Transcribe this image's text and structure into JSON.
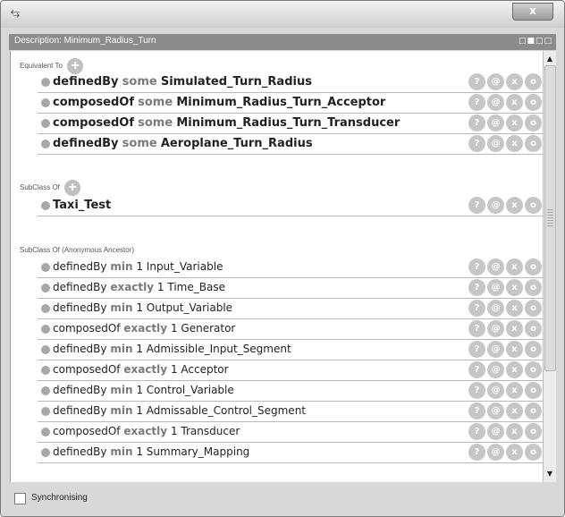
{
  "window": {
    "close_glyph": "x",
    "icon": "ontology-tool-icon"
  },
  "panel": {
    "title": "Description: Minimum_Radius_Turn",
    "controls": "□■□□"
  },
  "sections": {
    "equivalent": {
      "label": "Equivalent To",
      "rows": [
        {
          "prop": "definedBy",
          "kw": "some",
          "num": "",
          "target": "Simulated_Turn_Radius"
        },
        {
          "prop": "composedOf",
          "kw": "some",
          "num": "",
          "target": "Minimum_Radius_Turn_Acceptor"
        },
        {
          "prop": "composedOf",
          "kw": "some",
          "num": "",
          "target": "Minimum_Radius_Turn_Transducer"
        },
        {
          "prop": "definedBy",
          "kw": "some",
          "num": "",
          "target": "Aeroplane_Turn_Radius"
        }
      ]
    },
    "subclass": {
      "label": "SubClass Of",
      "rows": [
        {
          "prop": "Taxi_Test",
          "kw": "",
          "num": "",
          "target": ""
        }
      ]
    },
    "ancestor": {
      "label": "SubClass Of (Anonymous Ancestor)",
      "rows": [
        {
          "prop": "definedBy",
          "kw": "min",
          "num": "1",
          "target": "Input_Variable"
        },
        {
          "prop": "definedBy",
          "kw": "exactly",
          "num": "1",
          "target": "Time_Base"
        },
        {
          "prop": "definedBy",
          "kw": "min",
          "num": "1",
          "target": "Output_Variable"
        },
        {
          "prop": "composedOf",
          "kw": "exactly",
          "num": "1",
          "target": "Generator"
        },
        {
          "prop": "definedBy",
          "kw": "min",
          "num": "1",
          "target": "Admissible_Input_Segment"
        },
        {
          "prop": "composedOf",
          "kw": "exactly",
          "num": "1",
          "target": "Acceptor"
        },
        {
          "prop": "definedBy",
          "kw": "min",
          "num": "1",
          "target": "Control_Variable"
        },
        {
          "prop": "definedBy",
          "kw": "min",
          "num": "1",
          "target": "Admissable_Control_Segment"
        },
        {
          "prop": "composedOf",
          "kw": "exactly",
          "num": "1",
          "target": "Transducer"
        },
        {
          "prop": "definedBy",
          "kw": "min",
          "num": "1",
          "target": "Summary_Mapping"
        }
      ]
    }
  },
  "row_actions": [
    "?",
    "@",
    "x",
    "o"
  ],
  "add_glyph": "+",
  "footer": {
    "sync_label": "Synchronising",
    "sync_checked": false
  }
}
